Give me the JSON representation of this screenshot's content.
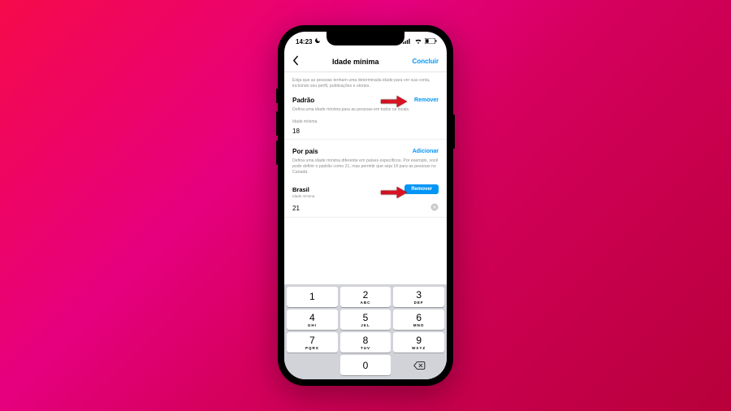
{
  "status": {
    "time": "14:23"
  },
  "nav": {
    "title": "Idade mínima",
    "done": "Concluir"
  },
  "intro": "Exija que as pessoas tenham uma determinada idade para ver sua conta, incluindo seu perfil, publicações e stories.",
  "default_section": {
    "title": "Padrão",
    "action": "Remover",
    "desc": "Defina uma idade mínima para as pessoas em todos os locais.",
    "field_label": "Idade mínima",
    "value": "18"
  },
  "country_section": {
    "title": "Por país",
    "action": "Adicionar",
    "desc": "Defina uma idade mínima diferente em países específicos. Por exemplo, você pode definir o padrão como 21, mas permitir que seja 18 para as pessoas no Canadá."
  },
  "country_item": {
    "name": "Brasil",
    "sub": "Idade mínima",
    "remove": "Remover",
    "value": "21"
  },
  "keypad": [
    {
      "n": "1",
      "l": ""
    },
    {
      "n": "2",
      "l": "ABC"
    },
    {
      "n": "3",
      "l": "DEF"
    },
    {
      "n": "4",
      "l": "GHI"
    },
    {
      "n": "5",
      "l": "JKL"
    },
    {
      "n": "6",
      "l": "MNO"
    },
    {
      "n": "7",
      "l": "PQRS"
    },
    {
      "n": "8",
      "l": "TUV"
    },
    {
      "n": "9",
      "l": "WXYZ"
    },
    {
      "n": "0",
      "l": ""
    }
  ]
}
